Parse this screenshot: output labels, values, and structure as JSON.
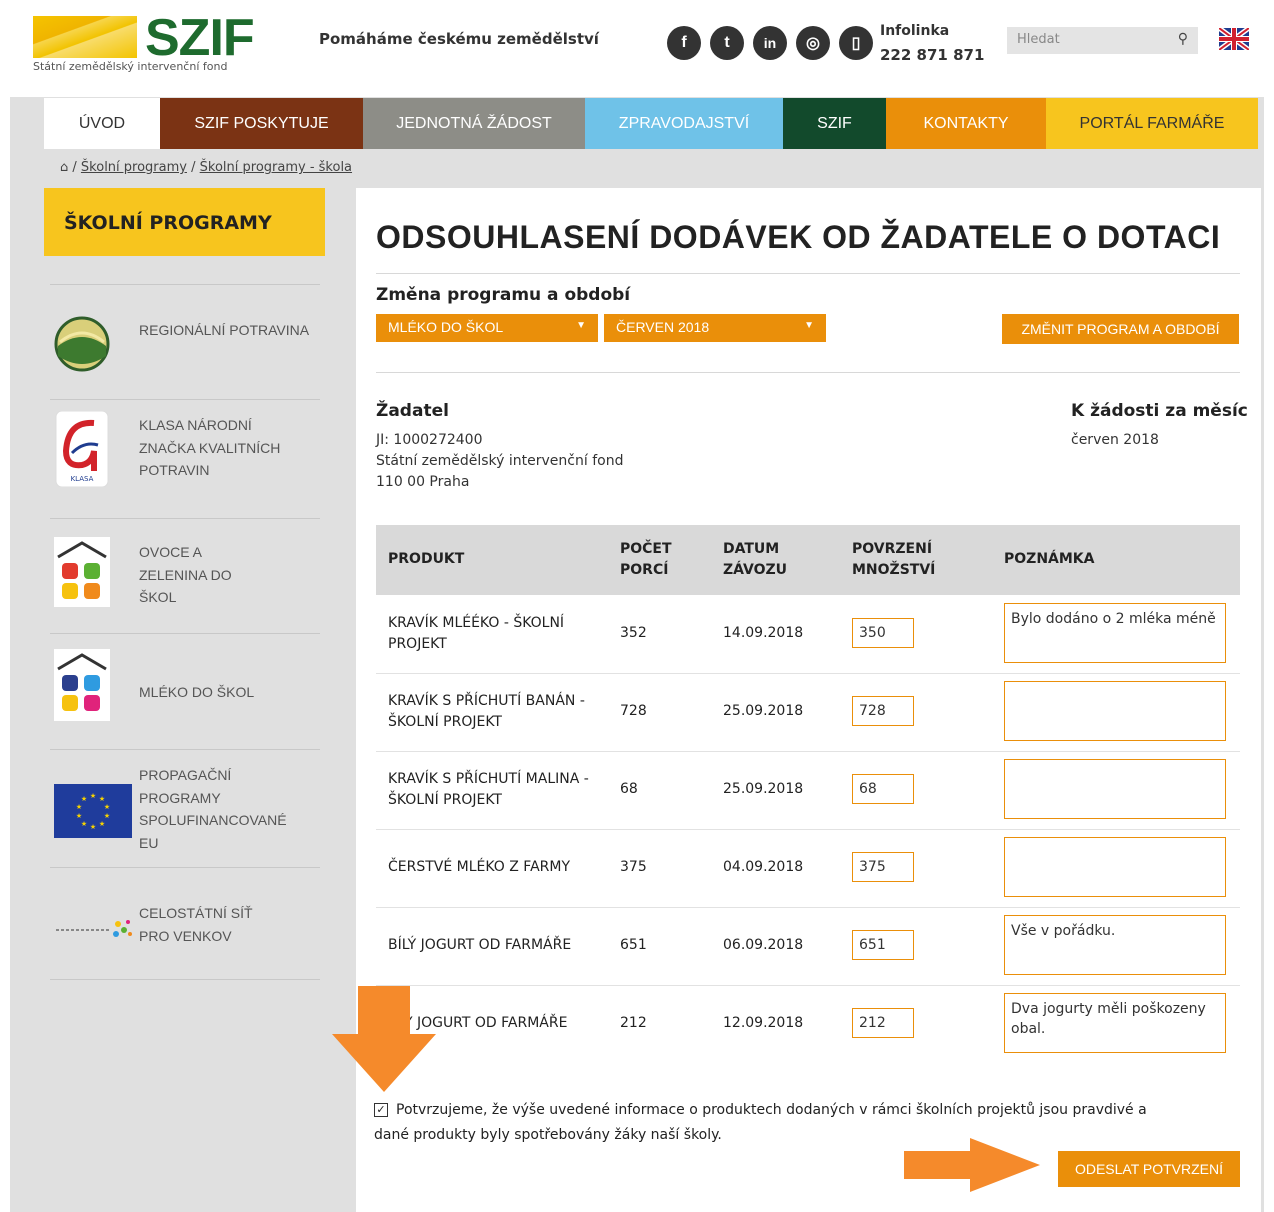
{
  "header": {
    "logo_text": "SZIF",
    "logo_subtitle": "Státní zemědělský intervenční fond",
    "tagline": "Pomáháme českému zemědělství",
    "social": [
      {
        "icon": "facebook-icon",
        "glyph": "f"
      },
      {
        "icon": "twitter-icon",
        "glyph": "t"
      },
      {
        "icon": "linkedin-icon",
        "glyph": "in"
      },
      {
        "icon": "instagram-icon",
        "glyph": "◎"
      },
      {
        "icon": "phone-icon",
        "glyph": "▯"
      }
    ],
    "infolinka_label": "Infolinka",
    "infolinka_number": "222 871 871",
    "search_placeholder": "Hledat",
    "search_icon": "search-icon",
    "language_icon": "uk-flag-icon"
  },
  "nav": [
    {
      "label": "ÚVOD",
      "bg": "#ffffff",
      "color": "#333333",
      "active": true
    },
    {
      "label": "SZIF POSKYTUJE",
      "bg": "#7b3314",
      "color": "#ffffff"
    },
    {
      "label": "JEDNOTNÁ ŽÁDOST",
      "bg": "#8d8d87",
      "color": "#ffffff"
    },
    {
      "label": "ZPRAVODAJSTVÍ",
      "bg": "#6fc2e8",
      "color": "#ffffff"
    },
    {
      "label": "SZIF",
      "bg": "#124a2c",
      "color": "#ffffff"
    },
    {
      "label": "KONTAKTY",
      "bg": "#ea8f0a",
      "color": "#ffffff"
    },
    {
      "label": "PORTÁL FARMÁŘE",
      "bg": "#f7c51e",
      "color": "#333333"
    }
  ],
  "breadcrumb": {
    "home_icon": "home-icon",
    "items": [
      "Školní programy",
      "Školní programy - škola"
    ]
  },
  "sidebar": {
    "heading": "ŠKOLNÍ PROGRAMY",
    "items": [
      {
        "label": "REGIONÁLNÍ POTRAVINA",
        "icon": "regionalni-potravina-logo"
      },
      {
        "label": "KLASA NÁRODNÍ ZNAČKA KVALITNÍCH POTRAVIN",
        "icon": "klasa-logo"
      },
      {
        "label": "OVOCE A ZELENINA DO ŠKOL",
        "icon": "ovoce-zelenina-logo"
      },
      {
        "label": "MLÉKO DO ŠKOL",
        "icon": "mleko-do-skol-logo"
      },
      {
        "label": "PROPAGAČNÍ PROGRAMY SPOLUFINANCOVANÉ EU",
        "icon": "eu-flag-logo"
      },
      {
        "label": "CELOSTÁTNÍ SÍŤ PRO VENKOV",
        "icon": "celostatni-sit-logo"
      }
    ]
  },
  "main": {
    "title": "ODSOUHLASENÍ DODÁVEK OD ŽADATELE O DOTACI",
    "program_section_label": "Změna programu a období",
    "program_select": "MLÉKO DO ŠKOL",
    "period_select": "ČERVEN 2018",
    "change_button": "ZMĚNIT PROGRAM A OBDOBÍ",
    "applicant_heading": "Žadatel",
    "applicant_lines": [
      "JI: 1000272400",
      "Státní zemědělský intervenční fond",
      "110 00 Praha"
    ],
    "month_heading": "K žádosti za měsíc",
    "month_value": "červen 2018",
    "table": {
      "headers": [
        "PRODUKT",
        "POČET PORCÍ",
        "DATUM ZÁVOZU",
        "POVRZENÍ MNOŽSTVÍ",
        "POZNÁMKA"
      ],
      "rows": [
        {
          "product": "KRAVÍK MLÉÉKO - ŠKOLNÍ PROJEKT",
          "portions": "352",
          "date": "14.09.2018",
          "confirmed": "350",
          "note": "Bylo dodáno o 2 mléka méně"
        },
        {
          "product": "KRAVÍK S PŘÍCHUTÍ BANÁN - ŠKOLNÍ PROJEKT",
          "portions": "728",
          "date": "25.09.2018",
          "confirmed": "728",
          "note": ""
        },
        {
          "product": "KRAVÍK S PŘÍCHUTÍ MALINA - ŠKOLNÍ PROJEKT",
          "portions": "68",
          "date": "25.09.2018",
          "confirmed": "68",
          "note": ""
        },
        {
          "product": "ČERSTVÉ MLÉKO Z FARMY",
          "portions": "375",
          "date": "04.09.2018",
          "confirmed": "375",
          "note": ""
        },
        {
          "product": "BÍLÝ JOGURT OD FARMÁŘE",
          "portions": "651",
          "date": "06.09.2018",
          "confirmed": "651",
          "note": "Vše v pořádku."
        },
        {
          "product": "ĹÝ JOGURT OD FARMÁŘE",
          "portions": "212",
          "date": "12.09.2018",
          "confirmed": "212",
          "note": "Dva jogurty měli poškozeny obal."
        }
      ]
    },
    "confirm_text": "Potvrzujeme, že výše uvedené informace o produktech dodaných v rámci školních projektů jsou pravdivé a dané produkty byly spotřebovány žáky naší školy.",
    "confirm_checked": true,
    "submit_button": "ODESLAT POTVRZENÍ"
  },
  "colors": {
    "accent_orange": "#ea8f0a",
    "annotation_arrow": "#f58a2b",
    "brand_green": "#1e6b2e",
    "brand_yellow": "#f7c51e"
  }
}
